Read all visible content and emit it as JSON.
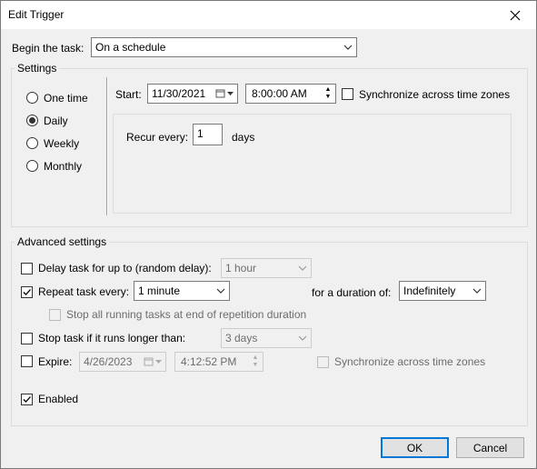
{
  "window": {
    "title": "Edit Trigger"
  },
  "begin": {
    "label": "Begin the task:",
    "value": "On a schedule"
  },
  "settings": {
    "group_title": "Settings",
    "radios": [
      {
        "label": "One time",
        "checked": false
      },
      {
        "label": "Daily",
        "checked": true
      },
      {
        "label": "Weekly",
        "checked": false
      },
      {
        "label": "Monthly",
        "checked": false
      }
    ],
    "start_label": "Start:",
    "start_date": "11/30/2021",
    "start_time": "8:00:00 AM",
    "sync_label": "Synchronize across time zones",
    "sync_checked": false,
    "recur_label": "Recur every:",
    "recur_value": "1",
    "recur_unit": "days"
  },
  "advanced": {
    "group_title": "Advanced settings",
    "delay_label": "Delay task for up to (random delay):",
    "delay_checked": false,
    "delay_value": "1 hour",
    "repeat_label": "Repeat task every:",
    "repeat_checked": true,
    "repeat_value": "1 minute",
    "duration_label": "for a duration of:",
    "duration_value": "Indefinitely",
    "stop_all_label": "Stop all running tasks at end of repetition duration",
    "stop_all_checked": false,
    "stop_longer_label": "Stop task if it runs longer than:",
    "stop_longer_checked": false,
    "stop_longer_value": "3 days",
    "expire_label": "Expire:",
    "expire_checked": false,
    "expire_date": "4/26/2023",
    "expire_time": "4:12:52 PM",
    "expire_sync_label": "Synchronize across time zones",
    "expire_sync_checked": false,
    "enabled_label": "Enabled",
    "enabled_checked": true
  },
  "buttons": {
    "ok": "OK",
    "cancel": "Cancel"
  }
}
